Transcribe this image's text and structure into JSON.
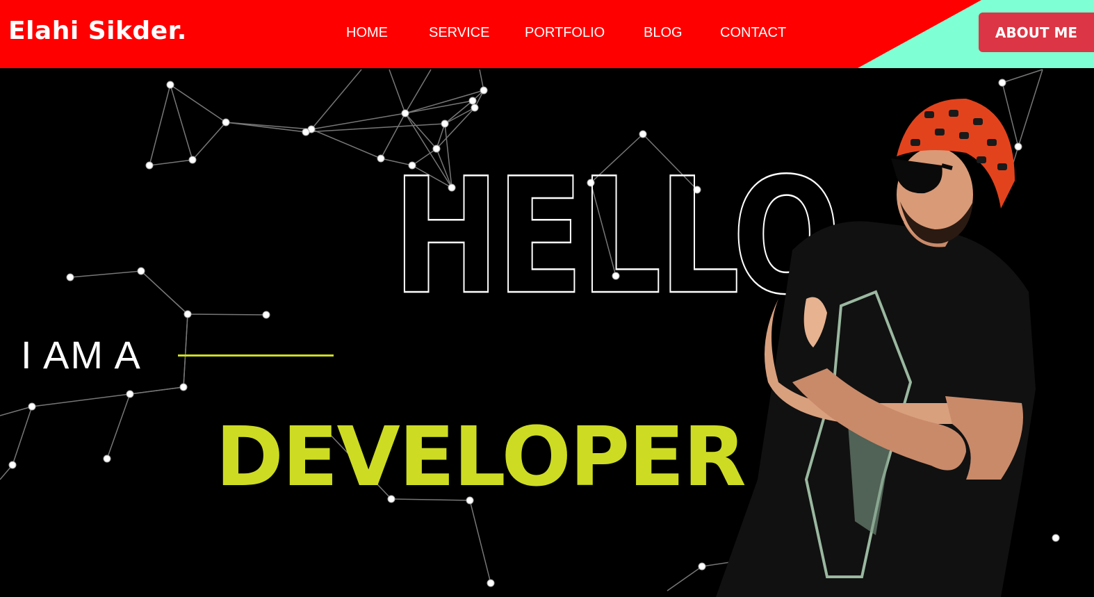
{
  "brand": {
    "name": "Elahi Sikder."
  },
  "nav": {
    "items": [
      {
        "label": "HOME"
      },
      {
        "label": "SERVICE"
      },
      {
        "label": "PORTFOLIO"
      },
      {
        "label": "BLOG"
      },
      {
        "label": "CONTACT"
      }
    ],
    "about_label": "ABOUT ME"
  },
  "hero": {
    "hello": "HELLO",
    "intro": "I AM A",
    "role": "DEVELOPER"
  },
  "colors": {
    "nav_bg": "#ff0000",
    "nav_accent": "#7fffd4",
    "about_button": "#dc3545",
    "highlight": "#cddc22",
    "background": "#000000"
  }
}
